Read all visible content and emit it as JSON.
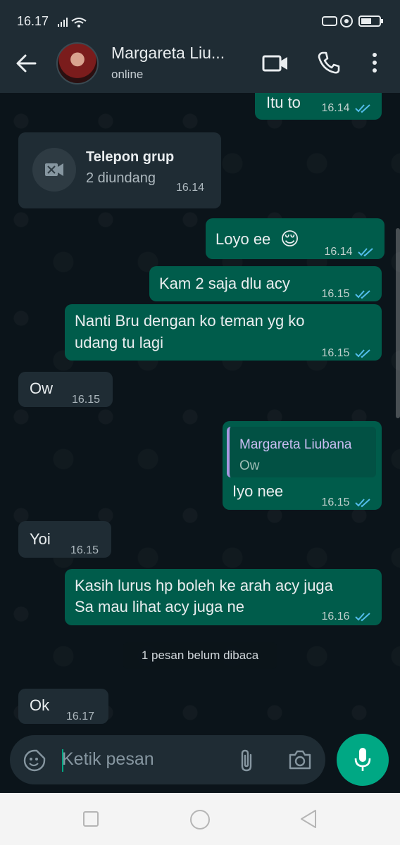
{
  "status_bar": {
    "time": "16.17"
  },
  "header": {
    "contact_name": "Margareta Liu...",
    "status": "online"
  },
  "messages": [
    {
      "text": "Itu to",
      "time": "16.14"
    },
    {
      "text": "Loyo ee",
      "emoji": "😌",
      "time": "16.14"
    },
    {
      "text": "Kam 2 saja dlu acy",
      "time": "16.15"
    },
    {
      "line1": "Nanti Bru dengan ko teman yg ko",
      "line2": "udang tu lagi",
      "time": "16.15"
    },
    {
      "text": "Ow",
      "time": "16.15"
    },
    {
      "quote_author": "Margareta Liubana",
      "quote_text": "Ow",
      "text": "Iyo nee",
      "time": "16.15"
    },
    {
      "text": "Yoi",
      "time": "16.15"
    },
    {
      "line1": "Kasih lurus hp boleh ke arah acy juga",
      "line2": "Sa mau lihat acy juga ne",
      "time": "16.16"
    },
    {
      "text": "Ok",
      "time": "16.17"
    }
  ],
  "call_card": {
    "title": "Telepon grup",
    "subtitle": "2 diundang",
    "time": "16.14"
  },
  "unread_banner": "1 pesan belum dibaca",
  "composer": {
    "placeholder": "Ketik pesan"
  },
  "colors": {
    "outgoing_bubble": "#005c4b",
    "incoming_bubble": "#1f2c34",
    "accent": "#00a884",
    "read_ticks": "#53bdeb"
  },
  "icons": [
    "back-arrow-icon",
    "video-call-icon",
    "voice-call-icon",
    "more-options-icon",
    "group-video-call-icon",
    "double-check-icon",
    "emoji-sticker-icon",
    "attachment-icon",
    "camera-icon",
    "microphone-icon",
    "nav-recents-icon",
    "nav-home-icon",
    "nav-back-icon"
  ]
}
